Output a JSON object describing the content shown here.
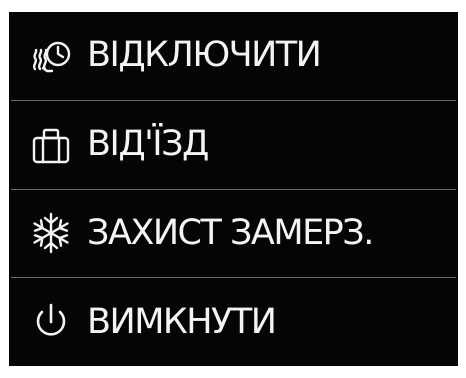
{
  "menu": {
    "items": [
      {
        "label": "ВІДКЛЮЧИТИ",
        "icon": "heat-timer-icon"
      },
      {
        "label": "ВІД'ЇЗД",
        "icon": "suitcase-icon"
      },
      {
        "label": "ЗАХИСТ ЗАМЕРЗ.",
        "icon": "snowflake-icon"
      },
      {
        "label": "ВИМКНУТИ",
        "icon": "power-icon"
      }
    ]
  },
  "colors": {
    "background": "#050505",
    "text": "#f4f4f4",
    "divider": "#6b6b6b"
  }
}
